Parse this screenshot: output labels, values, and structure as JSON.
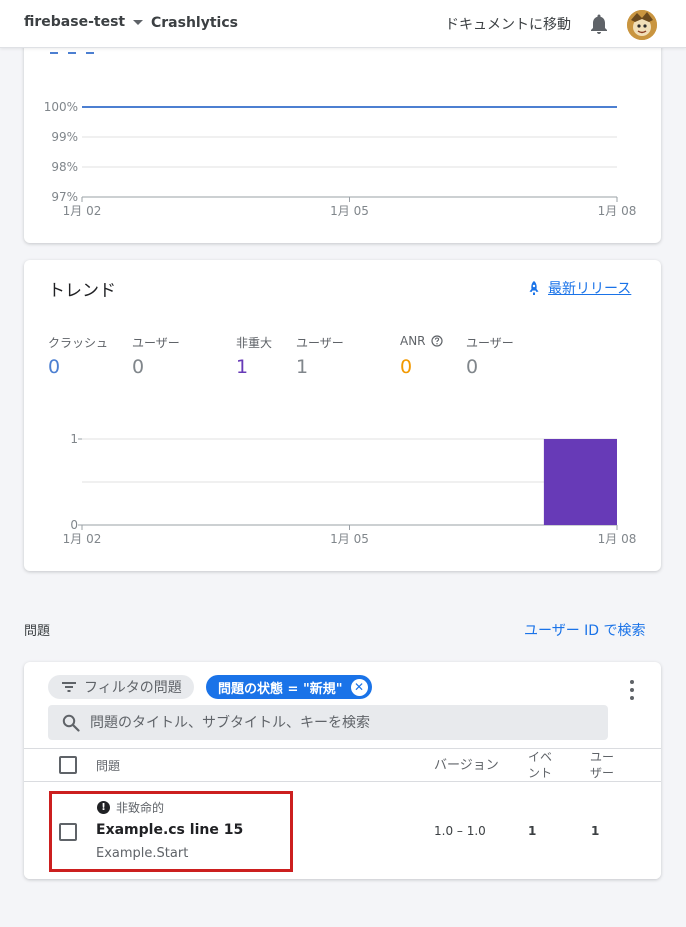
{
  "topbar": {
    "project_name": "firebase-test",
    "breadcrumb": "Crashlytics",
    "docs_link": "ドキュメントに移動"
  },
  "crashfree_chart": {
    "y_ticks": [
      "100%",
      "99%",
      "98%",
      "97%"
    ],
    "x_ticks": [
      "1月 02",
      "1月 05",
      "1月 08"
    ]
  },
  "trends": {
    "title": "トレンド",
    "latest_release_link": "最新リリース",
    "metrics": [
      {
        "label": "クラッシュ",
        "value": "0",
        "color": "#4c7fd1"
      },
      {
        "label": "ユーザー",
        "value": "0",
        "color": "#80868b"
      },
      {
        "label": "非重大",
        "value": "1",
        "color": "#673ab7"
      },
      {
        "label": "ユーザー",
        "value": "1",
        "color": "#80868b"
      },
      {
        "label": "ANR",
        "value": "0",
        "color": "#f29900"
      },
      {
        "label": "ユーザー",
        "value": "0",
        "color": "#80868b"
      }
    ]
  },
  "chart_data": [
    {
      "type": "line",
      "title": "",
      "x": [
        "1月 02",
        "1月 05",
        "1月 08"
      ],
      "series": [
        {
          "values": [
            100,
            100,
            100
          ],
          "color": "#4c7fd1"
        }
      ],
      "ylim": [
        97,
        100
      ],
      "yticks": [
        "97%",
        "98%",
        "99%",
        "100%"
      ],
      "grid": true
    },
    {
      "type": "bar",
      "title": "",
      "categories": [
        "1月 08"
      ],
      "values": [
        1
      ],
      "xlim": [
        "1月 02",
        "1月 08"
      ],
      "xticks": [
        "1月 02",
        "1月 05",
        "1月 08"
      ],
      "ylim": [
        0,
        1
      ],
      "yticks": [
        "0",
        "1"
      ],
      "color": "#673ab7",
      "grid": true
    }
  ],
  "issues": {
    "section_title": "問題",
    "search_by_user_link": "ユーザー ID で検索",
    "filter_chip": "フィルタの問題",
    "status_chip": "問題の状態 = \"新規\"",
    "search_placeholder": "問題のタイトル、サブタイトル、キーを検索",
    "columns": {
      "issue": "問題",
      "version": "バージョン",
      "events_line1": "イベ",
      "events_line2": "ント",
      "users_line1": "ユー",
      "users_line2": "ザー"
    },
    "rows": [
      {
        "severity": "非致命的",
        "title": "Example.cs line 15",
        "subtitle": "Example.Start",
        "version": "1.0 – 1.0",
        "events": "1",
        "users": "1"
      }
    ]
  }
}
